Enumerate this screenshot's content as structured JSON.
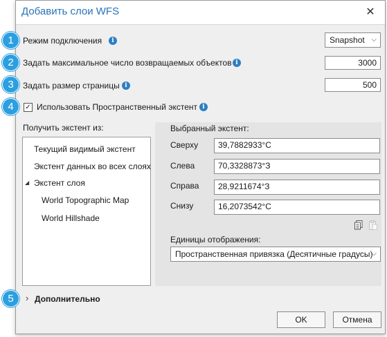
{
  "dialog": {
    "title": "Добавить слои WFS",
    "close_glyph": "✕"
  },
  "badges": [
    "1",
    "2",
    "3",
    "4",
    "5"
  ],
  "connection_mode": {
    "label": "Режим подключения",
    "value": "Snapshot"
  },
  "max_features": {
    "label": "Задать максимальное число возвращаемых объектов",
    "value": "3000"
  },
  "page_size": {
    "label": "Задать размер страницы",
    "value": "500"
  },
  "spatial_extent": {
    "label": "Использовать Пространственный экстент",
    "checked": true
  },
  "get_extent_from": {
    "label": "Получить экстент из:",
    "items": [
      "Текущий видимый экстент",
      "Экстент данных во всех слоях",
      "Экстент слоя",
      "World Topographic Map",
      "World Hillshade"
    ],
    "expanded_glyph": "◢"
  },
  "selected_extent": {
    "label": "Выбранный экстент:",
    "top_label": "Сверху",
    "top_value": "39,7882933°С",
    "left_label": "Слева",
    "left_value": "70,3328873°З",
    "right_label": "Справа",
    "right_value": "28,9211674°З",
    "bottom_label": "Снизу",
    "bottom_value": "16,2073542°С"
  },
  "display_units": {
    "label": "Единицы отображения:",
    "value": "Пространственная привязка (Десятичные градусы)"
  },
  "advanced": {
    "label": "Дополнительно",
    "chevron": "›"
  },
  "buttons": {
    "ok": "OK",
    "cancel": "Отмена"
  },
  "icons": {
    "info": "info-icon",
    "copy": "copy-icon",
    "paste": "paste-icon"
  },
  "colors": {
    "accent": "#2a73b8",
    "badge": "#2b9fe0",
    "info": "#2c7fc4"
  }
}
